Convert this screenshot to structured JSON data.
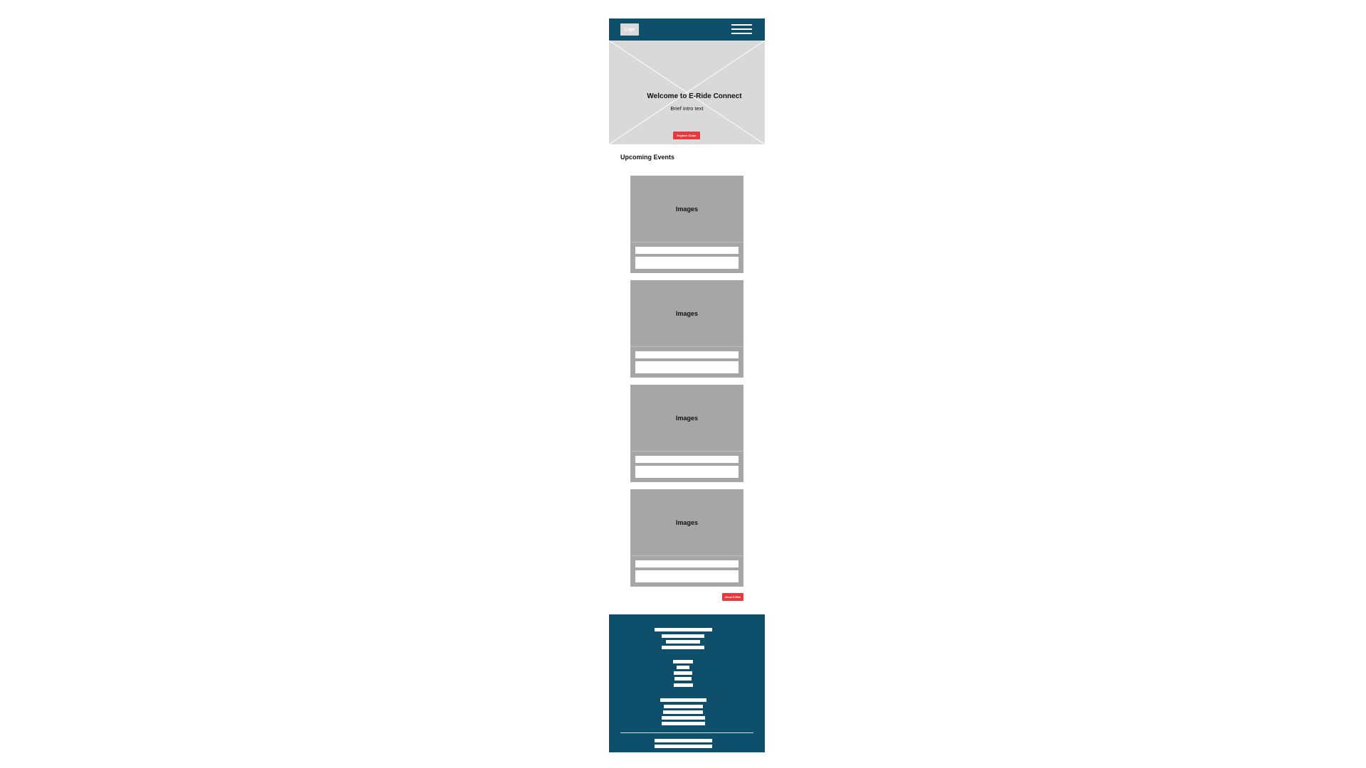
{
  "header": {
    "logo_text": "Logo",
    "menu_icon": "hamburger-menu-icon",
    "background_color": "#0e4f6b"
  },
  "hero": {
    "title": "Welcome to E-Ride Connect",
    "intro": "Brief intro text",
    "button_label": "Explore Clubs",
    "image_placeholder_icon": "image-placeholder-cross-icon",
    "button_color": "#e8383d"
  },
  "events": {
    "title": "Upcoming Events",
    "cards": [
      {
        "image_label": "Images"
      },
      {
        "image_label": "Images"
      },
      {
        "image_label": "Images"
      },
      {
        "image_label": "Images"
      }
    ]
  },
  "about_button": {
    "label": "About E-Ride"
  },
  "footer": {
    "background_color": "#0e4f6b",
    "groups": [
      {
        "line_count": 4
      },
      {
        "line_count": 5
      },
      {
        "line_count": 5
      },
      {
        "line_count": 2
      }
    ]
  }
}
